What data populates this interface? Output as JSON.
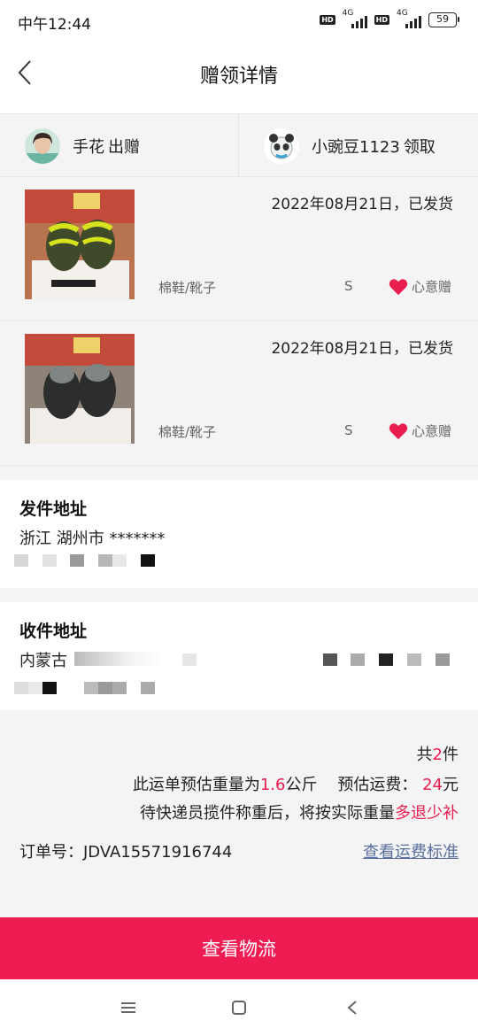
{
  "status_bar": {
    "time": "中午12:44",
    "hd_badge": "HD",
    "network": "4G",
    "battery": "59"
  },
  "header": {
    "title": "赠领详情",
    "back_icon": "chevron-left-icon"
  },
  "parties": {
    "giver": {
      "name": "手花",
      "action": "出赠"
    },
    "receiver": {
      "name": "小豌豆1123",
      "action": "领取"
    }
  },
  "items": [
    {
      "date_status": "2022年08月21日，已发货",
      "category": "棉鞋/靴子",
      "size": "S",
      "tag": "心意赠"
    },
    {
      "date_status": "2022年08月21日，已发货",
      "category": "棉鞋/靴子",
      "size": "S",
      "tag": "心意赠"
    }
  ],
  "sender_address": {
    "title": "发件地址",
    "line1": "浙江 湖州市 *******"
  },
  "receiver_address": {
    "title": "收件地址",
    "line1": "内蒙古"
  },
  "summary": {
    "count_prefix": "共",
    "count": "2",
    "count_suffix": "件",
    "weight_prefix": "此运单预估重量为",
    "weight": "1.6",
    "weight_unit": "公斤",
    "fee_label": "预估运费：",
    "fee": "24",
    "fee_unit": "元",
    "notice_prefix": "待快递员揽件称重后，将按实际重量",
    "notice_highlight": "多退少补",
    "order_label": "订单号：",
    "order_number": "JDVA15571916744",
    "fee_standard_link": "查看运费标准"
  },
  "logistics_button": "查看物流",
  "colors": {
    "accent": "#ee1c52",
    "link": "#5a6fa0"
  }
}
